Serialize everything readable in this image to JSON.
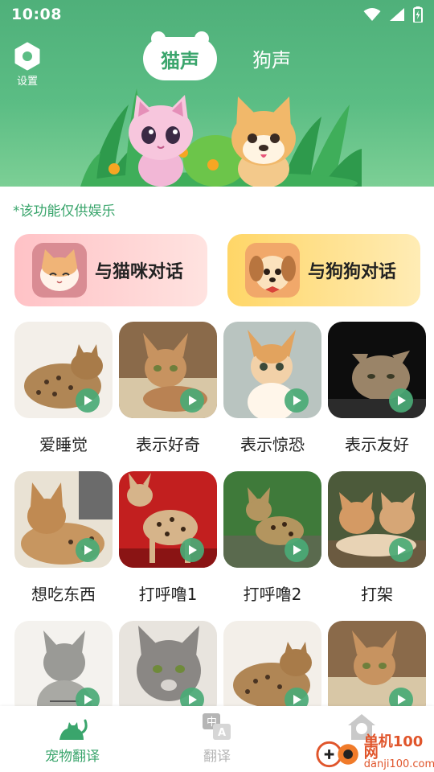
{
  "status_bar": {
    "time": "10:08"
  },
  "header": {
    "settings_label": "设置",
    "tabs": [
      {
        "label": "猫声",
        "selected": true
      },
      {
        "label": "狗声",
        "selected": false
      }
    ]
  },
  "notice": "*该功能仅供娱乐",
  "chat_buttons": {
    "cat_label": "与猫咪对话",
    "dog_label": "与狗狗对话"
  },
  "sounds": [
    {
      "label": "爱睡觉",
      "image": "cat-photo"
    },
    {
      "label": "表示好奇",
      "image": "cat-photo"
    },
    {
      "label": "表示惊恐",
      "image": "cat-photo"
    },
    {
      "label": "表示友好",
      "image": "cat-photo"
    },
    {
      "label": "想吃东西",
      "image": "cat-photo"
    },
    {
      "label": "打呼噜1",
      "image": "cat-photo"
    },
    {
      "label": "打呼噜2",
      "image": "cat-photo"
    },
    {
      "label": "打架",
      "image": "cat-photo"
    },
    {
      "label": "",
      "image": "cat-photo"
    },
    {
      "label": "",
      "image": "cat-photo"
    },
    {
      "label": "",
      "image": "cat-photo"
    },
    {
      "label": "",
      "image": "cat-photo"
    }
  ],
  "bottom_nav": [
    {
      "label": "宠物翻译",
      "icon": "cat-icon",
      "active": true
    },
    {
      "label": "翻译",
      "icon": "translate-icon",
      "active": false
    },
    {
      "label": "",
      "icon": "profile-icon",
      "active": false
    }
  ],
  "watermark": {
    "title": "单机100网",
    "url": "danji100.com"
  },
  "colors": {
    "accent": "#3aa56c",
    "header_green": "#5bbd84",
    "cat_button": "#ffc2c6",
    "dog_button": "#ffd667"
  }
}
